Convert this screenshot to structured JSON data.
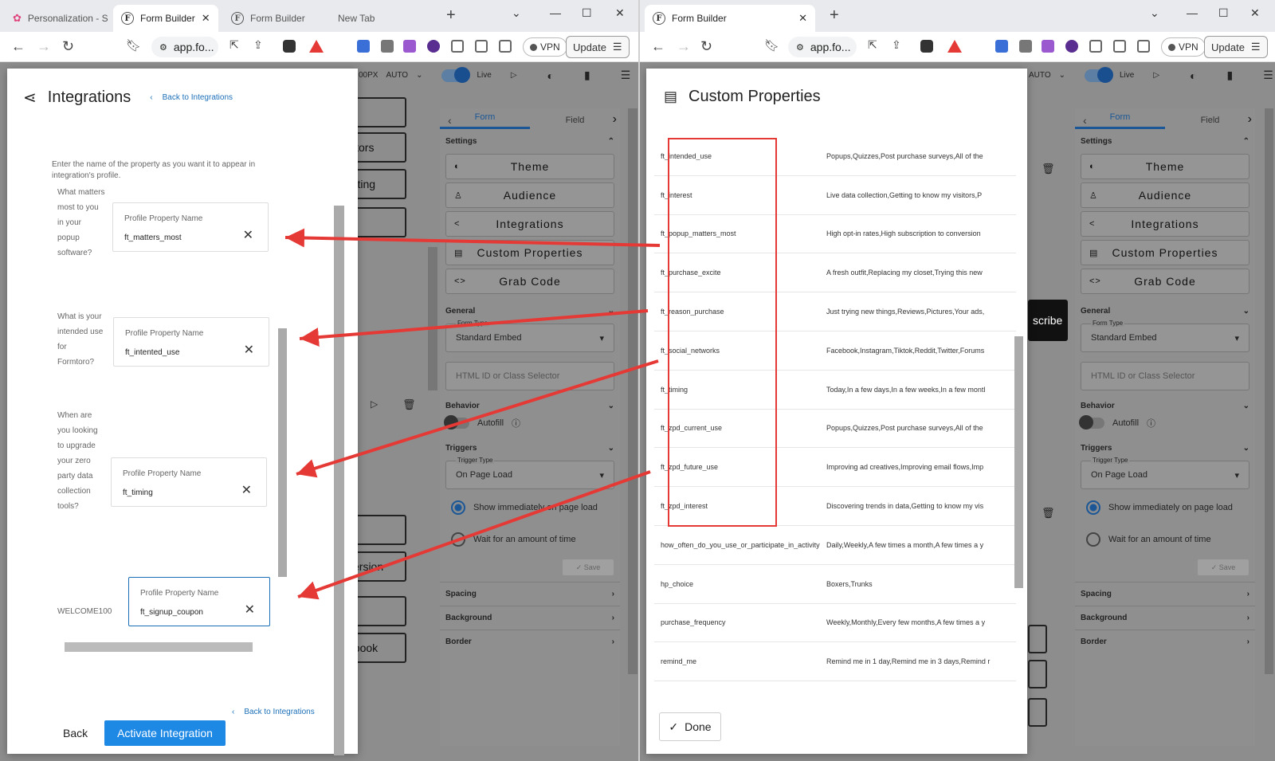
{
  "left_window": {
    "tabs": [
      {
        "label": "Personalization - S",
        "active": false
      },
      {
        "label": "Form Builder",
        "active": true
      },
      {
        "label": "Form Builder",
        "active": false
      },
      {
        "label": "New Tab",
        "active": false
      }
    ],
    "url": "app.fo...",
    "vpn_label": "VPN",
    "update_label": "Update"
  },
  "right_window": {
    "tabs": [
      {
        "label": "Form Builder",
        "active": true
      }
    ],
    "url": "app.fo...",
    "vpn_label": "VPN",
    "update_label": "Update"
  },
  "app_toolbar": {
    "width_text": "00PX",
    "auto_label": "AUTO",
    "live_label": "Live"
  },
  "side_panel": {
    "tab_form": "Form",
    "tab_field": "Field",
    "settings_label": "Settings",
    "buttons": [
      "Theme",
      "Audience",
      "Integrations",
      "Custom Properties",
      "Grab Code"
    ],
    "general_label": "General",
    "form_type_label": "Form Type",
    "form_type_value": "Standard Embed",
    "html_id_placeholder": "HTML ID or Class Selector",
    "behavior_label": "Behavior",
    "autofill_label": "Autofill",
    "triggers_label": "Triggers",
    "trigger_type_label": "Trigger Type",
    "trigger_type_value": "On Page Load",
    "show_immediately_label": "Show immediately on page load",
    "wait_label": "Wait for an amount of time",
    "save_label": "Save",
    "spacing_label": "Spacing",
    "background_label": "Background",
    "border_label": "Border"
  },
  "canvas_fragments": {
    "visitors": "sitors",
    "reporting": "orting",
    "version": "version",
    "ebook": "ebook",
    "subscribe": "scribe"
  },
  "integrations_modal": {
    "title": "Integrations",
    "back_link": "Back to Integrations",
    "hint": "Enter the name of the property as you want it to appear in integration's profile.",
    "property_label": "Profile Property Name",
    "items": [
      {
        "question": "What matters most to you in your popup software?",
        "value": "ft_matters_most"
      },
      {
        "question": "What is your intended use for Formtoro?",
        "value": "ft_intented_use"
      },
      {
        "question": "When are you looking to upgrade your zero party data collection tools?",
        "value": "ft_timing"
      }
    ],
    "coupon_question": "WELCOME100",
    "coupon_value": "ft_signup_coupon",
    "footer_back_link": "Back to Integrations",
    "back_button": "Back",
    "activate_button": "Activate Integration"
  },
  "custom_properties_modal": {
    "title": "Custom Properties",
    "rows": [
      {
        "key": "ft_intended_use",
        "value": "Popups,Quizzes,Post purchase surveys,All of the"
      },
      {
        "key": "ft_interest",
        "value": "Live data collection,Getting to know my visitors,P"
      },
      {
        "key": "ft_popup_matters_most",
        "value": "High opt-in rates,High subscription to conversion"
      },
      {
        "key": "ft_purchase_excite",
        "value": "A fresh outfit,Replacing my closet,Trying this new"
      },
      {
        "key": "ft_reason_purchase",
        "value": "Just trying new things,Reviews,Pictures,Your ads,"
      },
      {
        "key": "ft_social_networks",
        "value": "Facebook,Instagram,Tiktok,Reddit,Twitter,Forums"
      },
      {
        "key": "ft_timing",
        "value": "Today,In a few days,In a few weeks,In a few montl"
      },
      {
        "key": "ft_zpd_current_use",
        "value": "Popups,Quizzes,Post purchase surveys,All of the"
      },
      {
        "key": "ft_zpd_future_use",
        "value": "Improving ad creatives,Improving email flows,Imp"
      },
      {
        "key": "ft_zpd_interest",
        "value": "Discovering trends in data,Getting to know my vis"
      },
      {
        "key": "how_often_do_you_use_or_participate_in_activity",
        "value": "Daily,Weekly,A few times a month,A few times a y"
      },
      {
        "key": "hp_choice",
        "value": "Boxers,Trunks"
      },
      {
        "key": "purchase_frequency",
        "value": "Weekly,Monthly,Every few months,A few times a y"
      },
      {
        "key": "remind_me",
        "value": "Remind me in 1 day,Remind me in 3 days,Remind r"
      }
    ],
    "done_button": "Done"
  },
  "colors": {
    "accent": "#1e88e5",
    "annotation_red": "#e53935"
  }
}
